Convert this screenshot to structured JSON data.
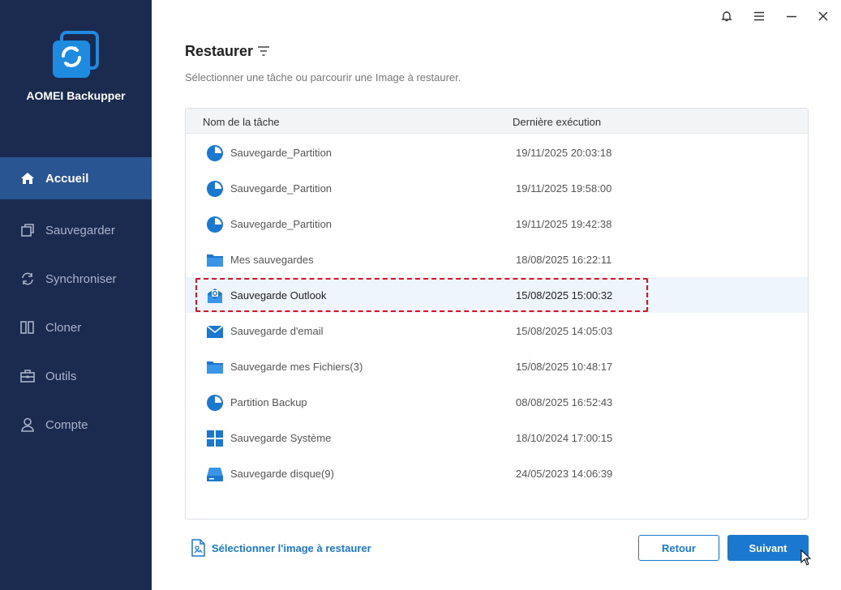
{
  "app": {
    "title": "AOMEI Backupper"
  },
  "sidebar": {
    "items": [
      {
        "label": "Accueil",
        "icon": "home-icon",
        "active": true
      },
      {
        "label": "Sauvegarder",
        "icon": "backup-icon",
        "active": false
      },
      {
        "label": "Synchroniser",
        "icon": "sync-icon",
        "active": false
      },
      {
        "label": "Cloner",
        "icon": "clone-icon",
        "active": false
      },
      {
        "label": "Outils",
        "icon": "toolbox-icon",
        "active": false
      },
      {
        "label": "Compte",
        "icon": "user-icon",
        "active": false
      }
    ]
  },
  "window_controls": [
    "bell-icon",
    "menu-icon",
    "minimize-icon",
    "close-icon"
  ],
  "header": {
    "title": "Restaurer",
    "subtitle": "Sélectionner une tâche ou parcourir une Image à restaurer."
  },
  "table": {
    "columns": {
      "name": "Nom de la tâche",
      "date": "Dernière exécution"
    },
    "rows": [
      {
        "name": "Sauvegarde_Partition",
        "date": "19/11/2025 20:03:18",
        "icon": "partition-icon"
      },
      {
        "name": "Sauvegarde_Partition",
        "date": "19/11/2025 19:58:00",
        "icon": "partition-icon"
      },
      {
        "name": "Sauvegarde_Partition",
        "date": "19/11/2025 19:42:38",
        "icon": "partition-icon"
      },
      {
        "name": "Mes sauvegardes",
        "date": "18/08/2025 16:22:11",
        "icon": "folder-icon"
      },
      {
        "name": "Sauvegarde Outlook",
        "date": "15/08/2025 15:00:32",
        "icon": "outlook-icon",
        "selected": true
      },
      {
        "name": "Sauvegarde d'email",
        "date": "15/08/2025 14:05:03",
        "icon": "email-icon"
      },
      {
        "name": "Sauvegarde mes Fichiers(3)",
        "date": "15/08/2025 10:48:17",
        "icon": "folder-icon"
      },
      {
        "name": "Partition Backup",
        "date": "08/08/2025 16:52:43",
        "icon": "partition-icon"
      },
      {
        "name": "Sauvegarde Système",
        "date": "18/10/2024 17:00:15",
        "icon": "windows-icon"
      },
      {
        "name": "Sauvegarde disque(9)",
        "date": "24/05/2023 14:06:39",
        "icon": "disk-icon"
      }
    ]
  },
  "footer": {
    "select_image_label": "Sélectionner l'image à restaurer",
    "back_label": "Retour",
    "next_label": "Suivant"
  },
  "colors": {
    "sidebar_bg": "#1b2a4f",
    "sidebar_active": "#2a5593",
    "accent": "#1a78d0",
    "highlight": "#d9121f"
  }
}
